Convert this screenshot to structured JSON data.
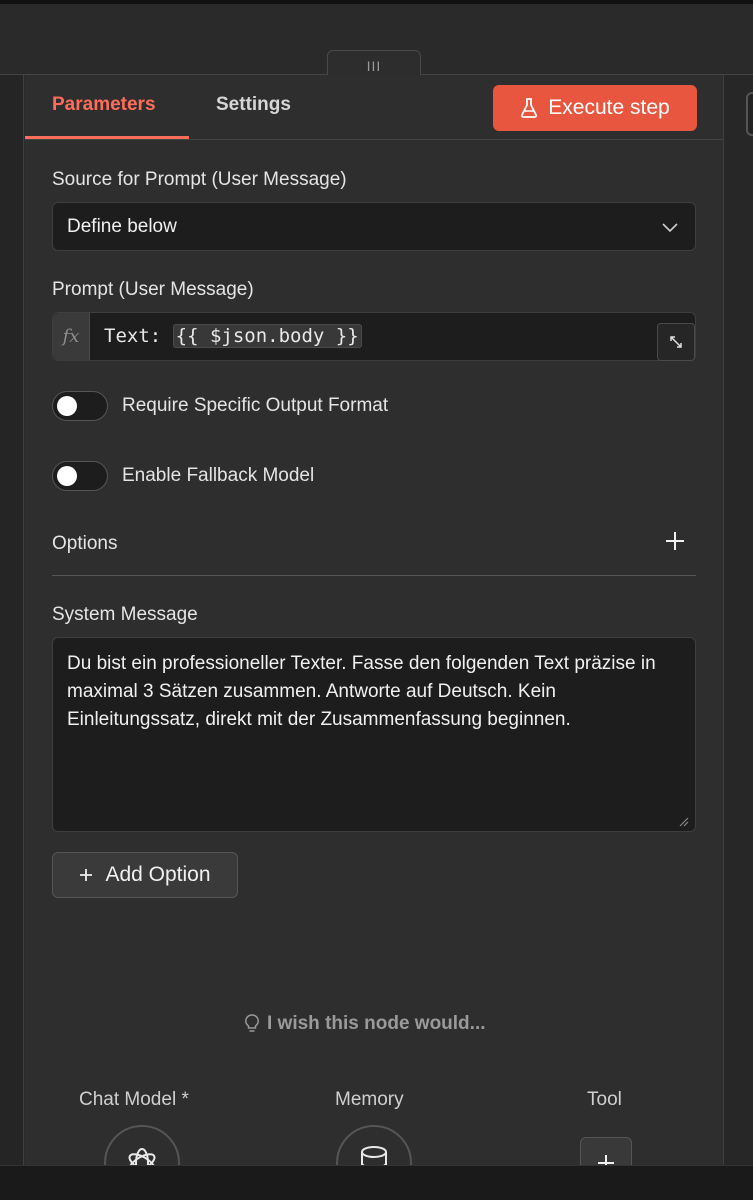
{
  "header": {
    "drag_handle_glyph": "III"
  },
  "tabs": [
    {
      "label": "Parameters",
      "active": true
    },
    {
      "label": "Settings",
      "active": false
    }
  ],
  "execute_button": {
    "label": "Execute step",
    "icon": "flask-icon",
    "color": "#e9563f"
  },
  "source_prompt": {
    "label": "Source for Prompt (User Message)",
    "selected": "Define below"
  },
  "prompt": {
    "label": "Prompt (User Message)",
    "fx_label": "fx",
    "text_prefix": "Text: ",
    "expression": "{{ $json.body }}"
  },
  "toggles": [
    {
      "label": "Require Specific Output Format",
      "on": false
    },
    {
      "label": "Enable Fallback Model",
      "on": false
    }
  ],
  "options": {
    "label": "Options"
  },
  "system_message": {
    "label": "System Message",
    "value": "Du bist ein professioneller Texter. Fasse den folgenden Text präzise in maximal 3 Sätzen zusammen. Antworte auf Deutsch. Kein Einleitungssatz, direkt mit der Zusammenfassung beginnen."
  },
  "add_option": {
    "label": "Add Option"
  },
  "wish": {
    "label": "I wish this node would..."
  },
  "sub_nodes": [
    {
      "label": "Chat Model *",
      "icon": "openai-icon"
    },
    {
      "label": "Memory",
      "icon": "database-icon"
    },
    {
      "label": "Tool",
      "icon": "plus-icon"
    }
  ],
  "colors": {
    "accent": "#ff6d5a",
    "background": "#2e2e2e",
    "input_background": "#1d1d1d"
  }
}
